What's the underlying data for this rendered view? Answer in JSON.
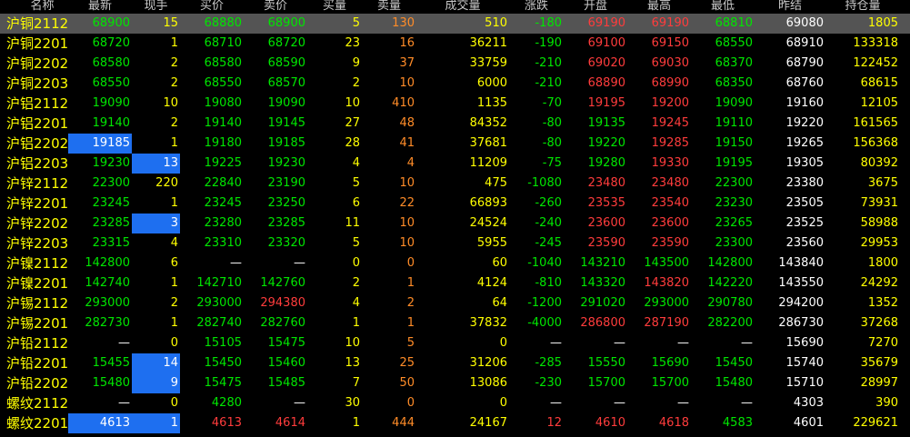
{
  "colors": {
    "background": "#000000",
    "selected_row": "#545454",
    "highlight": "#1e6ff0",
    "up": "#ff3c3c",
    "down": "#00e600",
    "flat": "#ffffff",
    "yellow": "#ffff00",
    "orange": "#ff8c28",
    "blue": "#78aaff"
  },
  "headers": {
    "name": "名称",
    "latest": "最新",
    "volume": "现手",
    "bid": "买价",
    "ask": "卖价",
    "bid_vol": "买量",
    "ask_vol": "卖量",
    "turnover": "成交量",
    "change": "涨跌",
    "open": "开盘",
    "high": "最高",
    "low": "最低",
    "prev_settle": "昨结",
    "open_interest": "持仓量"
  },
  "rows": [
    {
      "name": "沪铜2112",
      "latest": "68900",
      "volume": "15",
      "bid": "68880",
      "ask": "68900",
      "bid_vol": "5",
      "ask_vol": "130",
      "turnover": "510",
      "change": "-180",
      "open": "69190",
      "high": "69190",
      "low": "68810",
      "prev_settle": "69080",
      "open_interest": "1805"
    },
    {
      "name": "沪铜2201",
      "latest": "68720",
      "volume": "1",
      "bid": "68710",
      "ask": "68720",
      "bid_vol": "23",
      "ask_vol": "16",
      "turnover": "36211",
      "change": "-190",
      "open": "69100",
      "high": "69150",
      "low": "68550",
      "prev_settle": "68910",
      "open_interest": "133318"
    },
    {
      "name": "沪铜2202",
      "latest": "68580",
      "volume": "2",
      "bid": "68580",
      "ask": "68590",
      "bid_vol": "9",
      "ask_vol": "37",
      "turnover": "33759",
      "change": "-210",
      "open": "69020",
      "high": "69030",
      "low": "68370",
      "prev_settle": "68790",
      "open_interest": "122452"
    },
    {
      "name": "沪铜2203",
      "latest": "68550",
      "volume": "2",
      "bid": "68550",
      "ask": "68570",
      "bid_vol": "2",
      "ask_vol": "10",
      "turnover": "6000",
      "change": "-210",
      "open": "68890",
      "high": "68990",
      "low": "68350",
      "prev_settle": "68760",
      "open_interest": "68615"
    },
    {
      "name": "沪铝2112",
      "latest": "19090",
      "volume": "10",
      "bid": "19080",
      "ask": "19090",
      "bid_vol": "10",
      "ask_vol": "410",
      "turnover": "1135",
      "change": "-70",
      "open": "19195",
      "high": "19200",
      "low": "19090",
      "prev_settle": "19160",
      "open_interest": "12105"
    },
    {
      "name": "沪铝2201",
      "latest": "19140",
      "volume": "2",
      "bid": "19140",
      "ask": "19145",
      "bid_vol": "27",
      "ask_vol": "48",
      "turnover": "84352",
      "change": "-80",
      "open": "19135",
      "high": "19245",
      "low": "19110",
      "prev_settle": "19220",
      "open_interest": "161565"
    },
    {
      "name": "沪铝2202",
      "latest": "19185",
      "volume": "1",
      "bid": "19180",
      "ask": "19185",
      "bid_vol": "28",
      "ask_vol": "41",
      "turnover": "37681",
      "change": "-80",
      "open": "19220",
      "high": "19285",
      "low": "19150",
      "prev_settle": "19265",
      "open_interest": "156368"
    },
    {
      "name": "沪铝2203",
      "latest": "19230",
      "volume": "13",
      "bid": "19225",
      "ask": "19230",
      "bid_vol": "4",
      "ask_vol": "4",
      "turnover": "11209",
      "change": "-75",
      "open": "19280",
      "high": "19330",
      "low": "19195",
      "prev_settle": "19305",
      "open_interest": "80392"
    },
    {
      "name": "沪锌2112",
      "latest": "22300",
      "volume": "220",
      "bid": "22840",
      "ask": "23190",
      "bid_vol": "5",
      "ask_vol": "10",
      "turnover": "475",
      "change": "-1080",
      "open": "23480",
      "high": "23480",
      "low": "22300",
      "prev_settle": "23380",
      "open_interest": "3675"
    },
    {
      "name": "沪锌2201",
      "latest": "23245",
      "volume": "1",
      "bid": "23245",
      "ask": "23250",
      "bid_vol": "6",
      "ask_vol": "22",
      "turnover": "66893",
      "change": "-260",
      "open": "23535",
      "high": "23540",
      "low": "23230",
      "prev_settle": "23505",
      "open_interest": "73931"
    },
    {
      "name": "沪锌2202",
      "latest": "23285",
      "volume": "3",
      "bid": "23280",
      "ask": "23285",
      "bid_vol": "11",
      "ask_vol": "10",
      "turnover": "24524",
      "change": "-240",
      "open": "23600",
      "high": "23600",
      "low": "23265",
      "prev_settle": "23525",
      "open_interest": "58988"
    },
    {
      "name": "沪锌2203",
      "latest": "23315",
      "volume": "4",
      "bid": "23310",
      "ask": "23320",
      "bid_vol": "5",
      "ask_vol": "10",
      "turnover": "5955",
      "change": "-245",
      "open": "23590",
      "high": "23590",
      "low": "23300",
      "prev_settle": "23560",
      "open_interest": "29953"
    },
    {
      "name": "沪镍2112",
      "latest": "142800",
      "volume": "6",
      "bid": "—",
      "ask": "—",
      "bid_vol": "0",
      "ask_vol": "0",
      "turnover": "60",
      "change": "-1040",
      "open": "143210",
      "high": "143500",
      "low": "142800",
      "prev_settle": "143840",
      "open_interest": "1800"
    },
    {
      "name": "沪镍2201",
      "latest": "142740",
      "volume": "1",
      "bid": "142710",
      "ask": "142760",
      "bid_vol": "2",
      "ask_vol": "1",
      "turnover": "4124",
      "change": "-810",
      "open": "143320",
      "high": "143820",
      "low": "142220",
      "prev_settle": "143550",
      "open_interest": "24292"
    },
    {
      "name": "沪锡2112",
      "latest": "293000",
      "volume": "2",
      "bid": "293000",
      "ask": "294380",
      "bid_vol": "4",
      "ask_vol": "2",
      "turnover": "64",
      "change": "-1200",
      "open": "291020",
      "high": "293000",
      "low": "290780",
      "prev_settle": "294200",
      "open_interest": "1352"
    },
    {
      "name": "沪锡2201",
      "latest": "282730",
      "volume": "1",
      "bid": "282740",
      "ask": "282760",
      "bid_vol": "1",
      "ask_vol": "1",
      "turnover": "37832",
      "change": "-4000",
      "open": "286800",
      "high": "287190",
      "low": "282200",
      "prev_settle": "286730",
      "open_interest": "37268"
    },
    {
      "name": "沪铅2112",
      "latest": "—",
      "volume": "0",
      "bid": "15105",
      "ask": "15475",
      "bid_vol": "10",
      "ask_vol": "5",
      "turnover": "0",
      "change": "—",
      "open": "—",
      "high": "—",
      "low": "—",
      "prev_settle": "15690",
      "open_interest": "7270"
    },
    {
      "name": "沪铅2201",
      "latest": "15455",
      "volume": "14",
      "bid": "15450",
      "ask": "15460",
      "bid_vol": "13",
      "ask_vol": "25",
      "turnover": "31206",
      "change": "-285",
      "open": "15550",
      "high": "15690",
      "low": "15450",
      "prev_settle": "15740",
      "open_interest": "35679"
    },
    {
      "name": "沪铅2202",
      "latest": "15480",
      "volume": "9",
      "bid": "15475",
      "ask": "15485",
      "bid_vol": "7",
      "ask_vol": "50",
      "turnover": "13086",
      "change": "-230",
      "open": "15700",
      "high": "15700",
      "low": "15480",
      "prev_settle": "15710",
      "open_interest": "28997"
    },
    {
      "name": "螺纹2112",
      "latest": "—",
      "volume": "0",
      "bid": "4280",
      "ask": "—",
      "bid_vol": "30",
      "ask_vol": "0",
      "turnover": "0",
      "change": "—",
      "open": "—",
      "high": "—",
      "low": "—",
      "prev_settle": "4303",
      "open_interest": "390"
    },
    {
      "name": "螺纹2201",
      "latest": "4613",
      "volume": "1",
      "bid": "4613",
      "ask": "4614",
      "bid_vol": "1",
      "ask_vol": "444",
      "turnover": "24167",
      "change": "12",
      "open": "4610",
      "high": "4618",
      "low": "4583",
      "prev_settle": "4601",
      "open_interest": "229621"
    }
  ]
}
